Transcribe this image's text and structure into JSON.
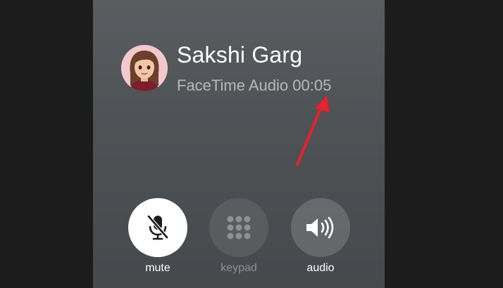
{
  "call": {
    "caller_name": "Sakshi Garg",
    "call_type": "FaceTime Audio",
    "duration": "00:05"
  },
  "controls": [
    {
      "label": "mute",
      "icon": "mic-slash-icon",
      "state": "active"
    },
    {
      "label": "keypad",
      "icon": "keypad-icon",
      "state": "disabled"
    },
    {
      "label": "audio",
      "icon": "speaker-icon",
      "state": "enabled"
    }
  ],
  "colors": {
    "annotation_arrow": "#e8212a",
    "screen_bg": "#4f5356",
    "status_text": "#b6b9bc"
  }
}
